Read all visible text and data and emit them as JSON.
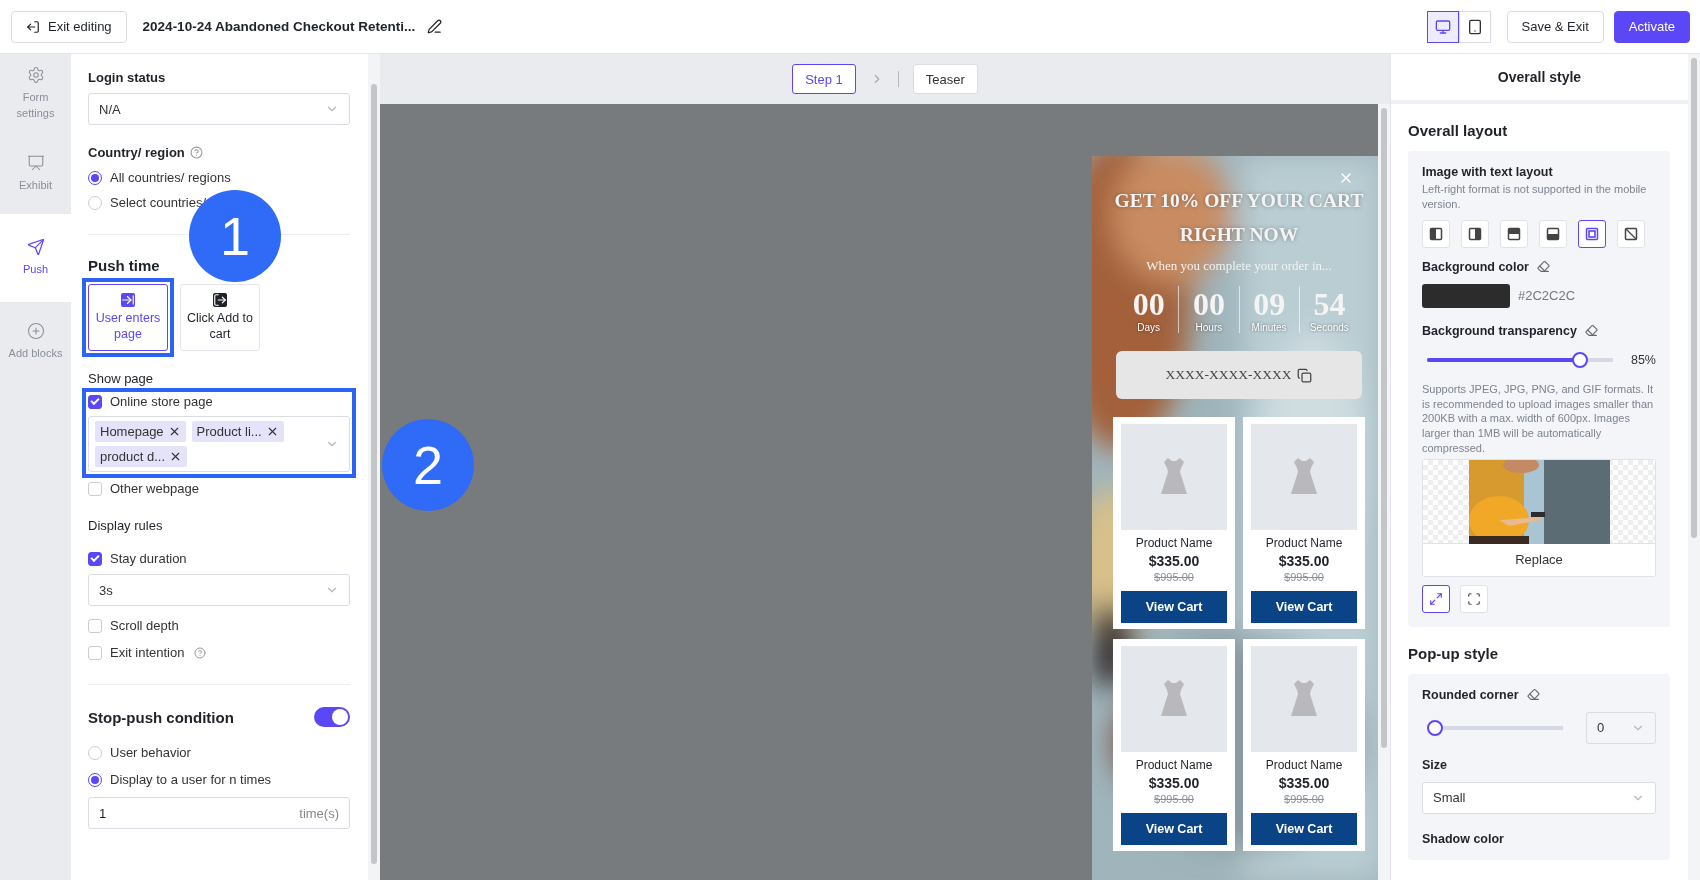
{
  "toolbar": {
    "exit_button": "Exit editing",
    "title": "2024-10-24 Abandoned Checkout Retenti...",
    "view_modes": [
      {
        "kind": "desktop",
        "selected": true
      },
      {
        "kind": "mobile",
        "selected": false
      }
    ],
    "save_button": "Save & Exit",
    "activate_button": "Activate"
  },
  "nav": [
    {
      "kind": "settings",
      "label": "Form settings",
      "selected": false
    },
    {
      "kind": "exhibit",
      "label": "Exhibit",
      "selected": false
    },
    {
      "kind": "push",
      "label": "Push",
      "selected": true
    },
    {
      "kind": "add",
      "label": "Add blocks",
      "selected": false
    }
  ],
  "settings": {
    "login_status": {
      "label": "Login status",
      "value": "N/A"
    },
    "country": {
      "label": "Country/ region",
      "options": [
        {
          "label": "All countries/ regions",
          "selected": true
        },
        {
          "label": "Select countries/",
          "selected": false
        }
      ]
    },
    "push_time": {
      "label": "Push time",
      "options": [
        {
          "kind": "enter",
          "label": "User enters page",
          "selected": true
        },
        {
          "kind": "cart",
          "label": "Click Add to cart",
          "selected": false
        }
      ]
    },
    "show_page": {
      "label": "Show page",
      "online_store": {
        "label": "Online store page",
        "checked": true
      },
      "tags": [
        "Homepage",
        "Product li...",
        "product d..."
      ],
      "other": {
        "label": "Other webpage",
        "checked": false
      }
    },
    "display_rules": {
      "label": "Display rules",
      "rules": [
        {
          "label": "Stay duration",
          "checked": true,
          "value": "3s"
        },
        {
          "label": "Scroll depth",
          "checked": false
        },
        {
          "label": "Exit intention",
          "checked": false,
          "help": true
        }
      ]
    },
    "stop_push": {
      "label": "Stop-push condition",
      "on": true,
      "options": [
        {
          "label": "User behavior",
          "selected": false
        },
        {
          "label": "Display to a user for n times",
          "selected": true
        }
      ],
      "count": "1",
      "unit": "time(s)"
    }
  },
  "annotations": [
    {
      "label": "1"
    },
    {
      "label": "2"
    }
  ],
  "steps": [
    {
      "label": "Step 1",
      "selected": true
    },
    {
      "label": "Teaser",
      "selected": false
    }
  ],
  "popup": {
    "headline": "GET 10% OFF YOUR CART RIGHT NOW",
    "subtitle": "When you complete your order in...",
    "countdown": [
      {
        "value": "00",
        "unit": "Days"
      },
      {
        "value": "00",
        "unit": "Hours"
      },
      {
        "value": "09",
        "unit": "Minutes"
      },
      {
        "value": "54",
        "unit": "Seconds"
      }
    ],
    "coupon": "XXXX-XXXX-XXXX",
    "products": [
      {
        "name": "Product Name",
        "price": "$335.00",
        "old_price": "$995.00",
        "button": "View Cart"
      },
      {
        "name": "Product Name",
        "price": "$335.00",
        "old_price": "$995.00",
        "button": "View Cart"
      },
      {
        "name": "Product Name",
        "price": "$335.00",
        "old_price": "$995.00",
        "button": "View Cart"
      },
      {
        "name": "Product Name",
        "price": "$335.00",
        "old_price": "$995.00",
        "button": "View Cart"
      }
    ]
  },
  "style_panel": {
    "title": "Overall style",
    "layout_section": "Overall layout",
    "layout_label": "Image with text layout",
    "layout_hint": "Left-right format is not supported in the mobile version.",
    "layouts": [
      {
        "kind": "left",
        "selected": false
      },
      {
        "kind": "right",
        "selected": false
      },
      {
        "kind": "top",
        "selected": false
      },
      {
        "kind": "bottom",
        "selected": false
      },
      {
        "kind": "background",
        "selected": true
      },
      {
        "kind": "none",
        "selected": false
      }
    ],
    "bg_color_label": "Background color",
    "bg_color": "#2C2C2C",
    "transparency_label": "Background transparency",
    "transparency": {
      "level": 0.85,
      "reading": "85%"
    },
    "image_hint": "Supports JPEG, JPG, PNG, and GIF formats. It is recommended to upload images smaller than 200KB with a max. width of 600px. Images larger than 1MB will be automatically compressed.",
    "replace_button": "Replace",
    "fit_modes": [
      {
        "kind": "fill",
        "selected": true
      },
      {
        "kind": "fit",
        "selected": false
      }
    ],
    "popup_section": "Pop-up style",
    "corner_label": "Rounded corner",
    "corner": {
      "level": 0,
      "value": "0"
    },
    "size_label": "Size",
    "size": "Small",
    "shadow_label": "Shadow color"
  }
}
